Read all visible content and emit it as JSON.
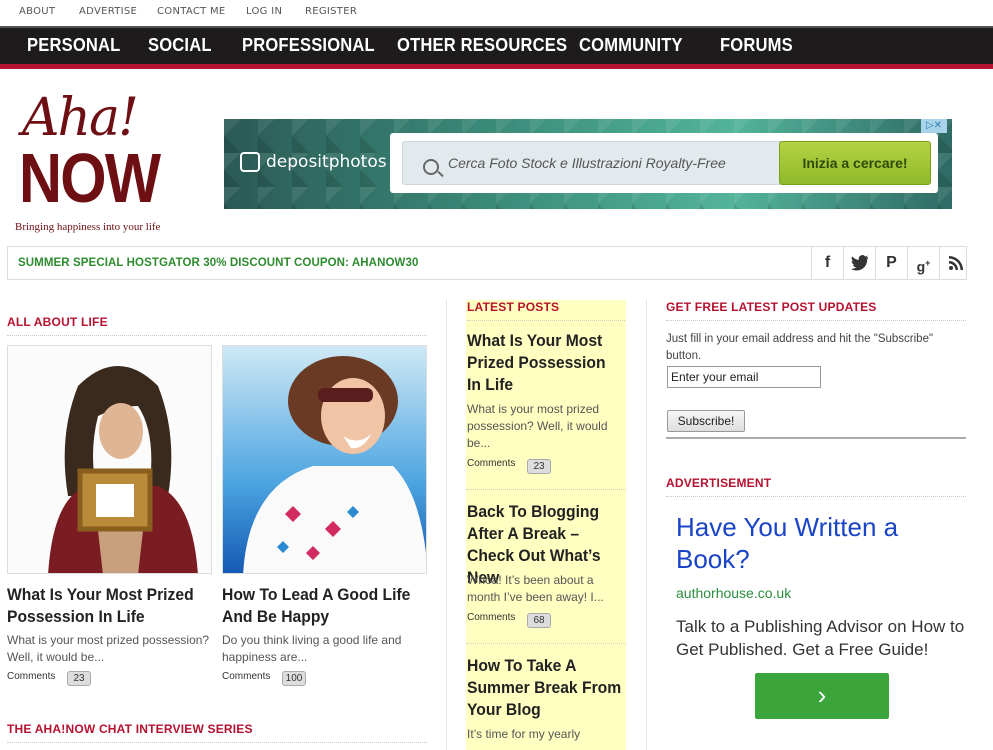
{
  "topbar": {
    "links": [
      "ABOUT",
      "ADVERTISE",
      "CONTACT ME",
      "LOG IN",
      "REGISTER"
    ]
  },
  "nav": {
    "items": [
      "PERSONAL",
      "SOCIAL",
      "PROFESSIONAL",
      "OTHER RESOURCES",
      "COMMUNITY",
      "FORUMS"
    ]
  },
  "logo": {
    "line1": "Aha!",
    "line2": "NOW",
    "tagline": "Bringing happiness into your life"
  },
  "ad_banner": {
    "brand": "depositphotos",
    "search_placeholder": "Cerca Foto Stock e Illustrazioni Royalty-Free",
    "cta": "Inizia a cercare!"
  },
  "coupon": {
    "text": "SUMMER SPECIAL HOSTGATOR 30% DISCOUNT COUPON: AHANOW30"
  },
  "social": [
    "facebook-icon",
    "twitter-icon",
    "pinterest-icon",
    "google-plus-icon",
    "rss-icon"
  ],
  "all_about_life": {
    "heading": "ALL ABOUT LIFE",
    "posts": [
      {
        "title": "What Is Your Most Prized Possession In Life",
        "excerpt": "What is your most prized possession? Well, it would be...",
        "comments_label": "Comments",
        "comments": "23"
      },
      {
        "title": "How To Lead A Good Life And Be Happy",
        "excerpt": "Do you think living a good life and happiness are...",
        "comments_label": "Comments",
        "comments": "100"
      }
    ]
  },
  "chat_series": {
    "heading": "THE AHA!NOW CHAT INTERVIEW SERIES"
  },
  "latest_posts": {
    "heading": "LATEST POSTS",
    "posts": [
      {
        "title": "What Is Your Most Prized Possession In Life",
        "excerpt": "What is your most prized possession? Well, it would be...",
        "comments_label": "Comments",
        "comments": "23"
      },
      {
        "title": "Back To Blogging After A Break – Check Out What’s New",
        "excerpt": "Whoa! It’s been about a month I’ve been away! I...",
        "comments_label": "Comments",
        "comments": "68"
      },
      {
        "title": "How To Take A Summer Break From Your Blog",
        "excerpt": "It’s time for my yearly"
      }
    ]
  },
  "subscribe": {
    "heading": "GET FREE LATEST POST UPDATES",
    "instructions": "Just fill in your email address and hit the \"Subscribe\" button.",
    "email_value": "Enter your email",
    "button": "Subscribe!"
  },
  "advertisement": {
    "heading": "ADVERTISEMENT",
    "headline": "Have You Written a Book?",
    "url": "authorhouse.co.uk",
    "description": "Talk to a Publishing Advisor on How to Get Published. Get a Free Guide!",
    "button_glyph": "›"
  },
  "colors": {
    "accent": "#b5122f",
    "nav_bg": "#1d1b1b",
    "logo": "#6e0f14",
    "coupon": "#2e8b2e",
    "latest_bg": "#ffffc2"
  }
}
